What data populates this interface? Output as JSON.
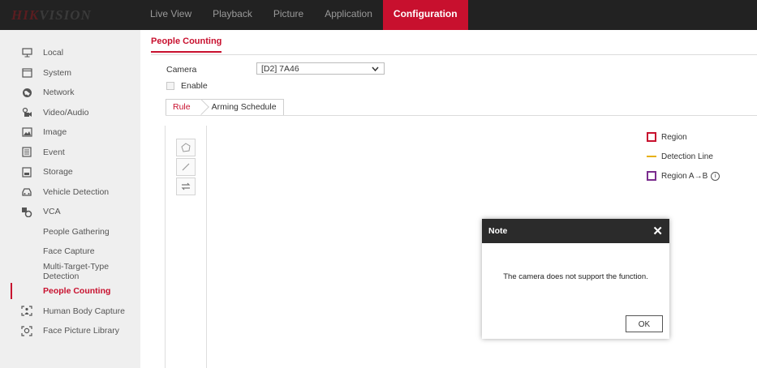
{
  "header": {
    "logo_hik": "HIK",
    "logo_vision": "VISION",
    "nav": [
      {
        "label": "Live View"
      },
      {
        "label": "Playback"
      },
      {
        "label": "Picture"
      },
      {
        "label": "Application"
      },
      {
        "label": "Configuration"
      }
    ]
  },
  "sidebar": {
    "items": [
      {
        "label": "Local",
        "icon": "monitor-icon"
      },
      {
        "label": "System",
        "icon": "window-icon"
      },
      {
        "label": "Network",
        "icon": "globe-icon"
      },
      {
        "label": "Video/Audio",
        "icon": "video-audio-icon"
      },
      {
        "label": "Image",
        "icon": "image-icon"
      },
      {
        "label": "Event",
        "icon": "event-icon"
      },
      {
        "label": "Storage",
        "icon": "storage-icon"
      },
      {
        "label": "Vehicle Detection",
        "icon": "vehicle-icon"
      },
      {
        "label": "VCA",
        "icon": "vca-icon"
      },
      {
        "label": "People Gathering"
      },
      {
        "label": "Face Capture"
      },
      {
        "label": "Multi-Target-Type Detection"
      },
      {
        "label": "People Counting"
      },
      {
        "label": "Human Body Capture",
        "icon": "human-body-icon"
      },
      {
        "label": "Face Picture Library",
        "icon": "face-library-icon"
      }
    ]
  },
  "main": {
    "page_tab": "People Counting",
    "camera_label": "Camera",
    "camera_value": "[D2] 7A46",
    "enable_label": "Enable",
    "enable_checked": false,
    "subtabs": [
      {
        "label": "Rule"
      },
      {
        "label": "Arming Schedule"
      }
    ],
    "tools": [
      "region-draw-icon",
      "line-draw-icon",
      "direction-swap-icon"
    ],
    "legend": {
      "region": "Region",
      "detection_line": "Detection Line",
      "region_ab": "Region A→B"
    }
  },
  "dialog": {
    "title": "Note",
    "message": "The camera does not support the function.",
    "ok_label": "OK"
  },
  "colors": {
    "accent": "#c8102e",
    "topbar": "#222222",
    "sidebar": "#efefef",
    "legend_region": "#c8102e",
    "legend_line": "#e7b010",
    "legend_region_ab": "#7b2d8e"
  }
}
